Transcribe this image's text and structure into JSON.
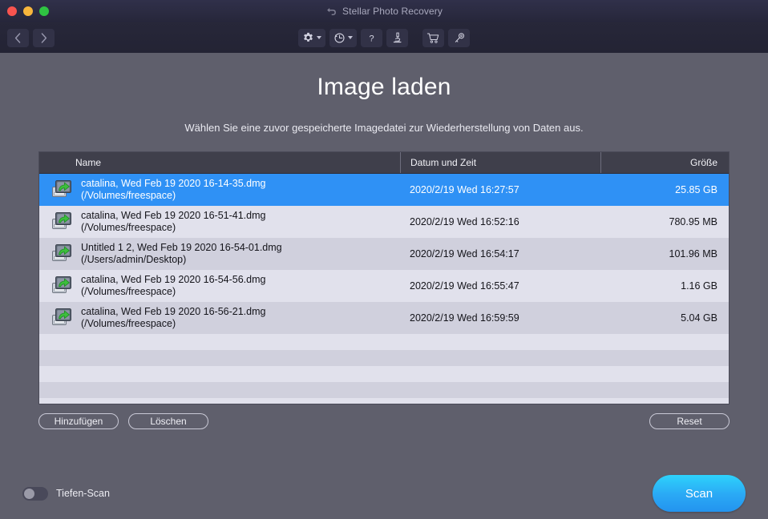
{
  "window": {
    "title": "Stellar Photo Recovery",
    "back_icon": "back-arrow-icon",
    "traffic_lights": [
      "close",
      "minimize",
      "zoom"
    ]
  },
  "toolbar": {
    "nav": [
      {
        "name": "back-button",
        "icon": "chevron-left-icon"
      },
      {
        "name": "forward-button",
        "icon": "chevron-right-icon"
      }
    ],
    "tools": [
      {
        "name": "settings-button",
        "icon": "gear-icon",
        "has_caret": true
      },
      {
        "name": "recovery-history-button",
        "icon": "clock-rotate-icon",
        "has_caret": true
      },
      {
        "name": "help-button",
        "icon": "question-mark-icon",
        "has_caret": false
      },
      {
        "name": "preview-button",
        "icon": "microscope-icon",
        "has_caret": false
      }
    ],
    "tools_right": [
      {
        "name": "buy-button",
        "icon": "shopping-cart-icon",
        "has_caret": false
      },
      {
        "name": "activate-button",
        "icon": "key-icon",
        "has_caret": false
      }
    ]
  },
  "page": {
    "title": "Image laden",
    "subtitle": "Wählen Sie eine zuvor gespeicherte Imagedatei zur Wiederherstellung von Daten aus."
  },
  "table": {
    "columns": {
      "name": "Name",
      "date": "Datum und Zeit",
      "size": "Größe"
    },
    "rows": [
      {
        "file": "catalina, Wed Feb 19 2020 16-14-35.dmg",
        "path": "(/Volumes/freespace)",
        "date": "2020/2/19 Wed 16:27:57",
        "size": "25.85 GB",
        "selected": true
      },
      {
        "file": "catalina, Wed Feb 19 2020 16-51-41.dmg",
        "path": "(/Volumes/freespace)",
        "date": "2020/2/19 Wed 16:52:16",
        "size": "780.95 MB",
        "selected": false
      },
      {
        "file": "Untitled 1 2, Wed Feb 19 2020 16-54-01.dmg",
        "path": "(/Users/admin/Desktop)",
        "date": "2020/2/19 Wed 16:54:17",
        "size": "101.96 MB",
        "selected": false
      },
      {
        "file": "catalina, Wed Feb 19 2020 16-54-56.dmg",
        "path": "(/Volumes/freespace)",
        "date": "2020/2/19 Wed 16:55:47",
        "size": "1.16 GB",
        "selected": false
      },
      {
        "file": "catalina, Wed Feb 19 2020 16-56-21.dmg",
        "path": "(/Volumes/freespace)",
        "date": "2020/2/19 Wed 16:59:59",
        "size": "5.04 GB",
        "selected": false
      }
    ],
    "empty_row_count": 5,
    "row_icon": "disk-image-icon"
  },
  "actions": {
    "add": "Hinzufügen",
    "delete": "Löschen",
    "reset": "Reset"
  },
  "footer": {
    "deep_scan_label": "Tiefen-Scan",
    "deep_scan_on": false,
    "scan_label": "Scan"
  },
  "colors": {
    "window_background": "#5f5f6c",
    "titlebar": "#2c2c43",
    "toolbar": "#252537",
    "table_header": "#3f3f4b",
    "row_light": "#e1e1ec",
    "row_dark": "#d0d0dd",
    "selection_blue": "#2f91f5",
    "scan_button": "#2aa8f5",
    "accent_green": "#3cbf3c"
  }
}
